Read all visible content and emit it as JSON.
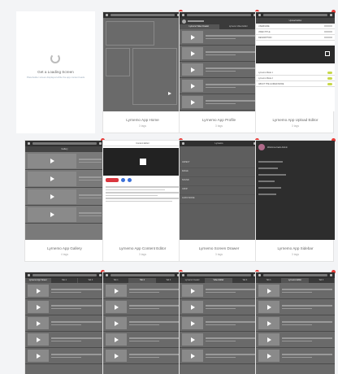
{
  "loading": {
    "title": "Get a Loading Screen",
    "subtitle": "Placeholder screen displayed while the app content loads"
  },
  "rows": [
    {
      "cards": [
        {
          "caption": "Lyrnemo App Home",
          "sub": "3 tags"
        },
        {
          "caption": "Lyrnemo App Profile",
          "sub": "3 tags"
        },
        {
          "caption": "Lyrnemo App Upload Editor",
          "sub": "3 tags"
        }
      ]
    },
    {
      "cards": [
        {
          "caption": "Lyrnemo App Gallery",
          "sub": "4 tags"
        },
        {
          "caption": "Lyrnemo App Content Editor",
          "sub": "3 tags"
        },
        {
          "caption": "Lyrnemo Screen Drawer",
          "sub": "3 tags"
        },
        {
          "caption": "Lyrnemo App Sidebar",
          "sub": "3 tags"
        }
      ]
    }
  ],
  "screens": {
    "profile_tabs": [
      "Lyrnemo Video Creator",
      "Lyrnemo Video Editor"
    ],
    "upload_title": "Upload Editor",
    "upload_fields": [
      "USERNAME",
      "VIDEO TITLE",
      "DESCRIPTION"
    ],
    "upload_toggles": [
      "Lyrnemo Mode 1",
      "Lyrnemo Mode 2",
      "ABOUT THE GUIDED MODE"
    ],
    "gallery_title": "Gallery",
    "editor_title": "Content Editor",
    "drawer_title": "Lyrnemo",
    "drawer_items": [
      "ASPECT",
      "IMAGE",
      "SOUND",
      "CROP",
      "AUDIO MODE"
    ],
    "sidebar_user": "Welcome back Admin",
    "bottom_tabs": [
      [
        "Lyrnemo App Viewer",
        "Tab 2",
        "Tab 3"
      ],
      [
        "Tab 1",
        "Tab 2",
        "Tab 3"
      ],
      [
        "Lyrnemo Creator",
        "Video Editor",
        "Tab 3"
      ],
      [
        "Tab 1",
        "Lyrnemo Editor",
        "Tab 3"
      ]
    ]
  }
}
